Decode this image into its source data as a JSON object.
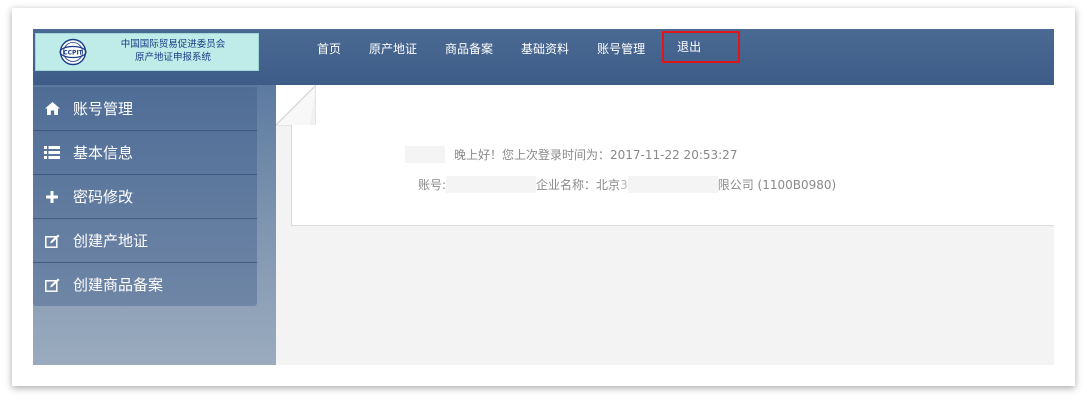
{
  "logo": {
    "line1": "中国国际贸易促进委员会",
    "line2": "原产地证申报系统",
    "mark_text": "CCPIT",
    "icon": "ccpit-logo-icon"
  },
  "nav": {
    "items": [
      {
        "label": "首页"
      },
      {
        "label": "原产地证"
      },
      {
        "label": "商品备案"
      },
      {
        "label": "基础资料"
      },
      {
        "label": "账号管理"
      }
    ],
    "logout_label": "退出",
    "logout_highlight_color": "#e0171a"
  },
  "sidebar": {
    "items": [
      {
        "label": "账号管理",
        "icon": "home-icon"
      },
      {
        "label": "基本信息",
        "icon": "list-icon"
      },
      {
        "label": "密码修改",
        "icon": "plus-icon"
      },
      {
        "label": "创建产地证",
        "icon": "edit-icon"
      },
      {
        "label": "创建商品备案",
        "icon": "edit-icon"
      }
    ]
  },
  "welcome": {
    "greeting": "晚上好！您上次登录时间为：2017-11-22 20:53:27",
    "account_label": "账号:",
    "company_label_partial": "企业名称：北京",
    "company_partial_char": "3",
    "company_suffix": "限公司 (1100B0980)"
  },
  "colors": {
    "topbar": "#4a6a94",
    "sidebar": "#4f6d96",
    "logo_bg": "#bfece8"
  }
}
